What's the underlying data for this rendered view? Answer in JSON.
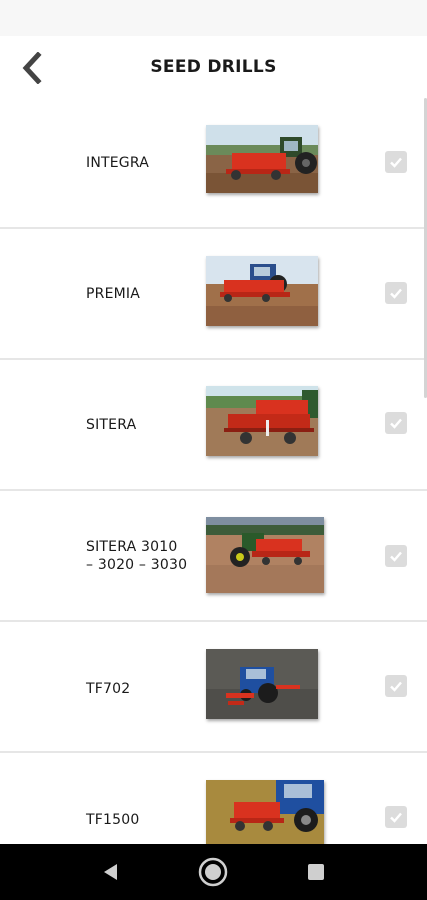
{
  "header": {
    "title": "SEED DRILLS",
    "back_icon": "chevron-left-icon"
  },
  "colors": {
    "status_bar": "#f7f7f7",
    "divider": "#e6e6e6",
    "checkbox_bg": "#dcdcdc",
    "nav_bar": "#000000",
    "machine_red": "#d9321f"
  },
  "items": [
    {
      "label": "INTEGRA",
      "checked": true,
      "image": "integra-photo"
    },
    {
      "label": "PREMIA",
      "checked": true,
      "image": "premia-photo"
    },
    {
      "label": "SITERA",
      "checked": true,
      "image": "sitera-photo"
    },
    {
      "label_line1": "SITERA 3010",
      "label_line2": "– 3020 – 3030",
      "checked": true,
      "image": "sitera-3010-photo"
    },
    {
      "label": "TF702",
      "checked": true,
      "image": "tf702-photo"
    },
    {
      "label": "TF1500",
      "checked": true,
      "image": "tf1500-photo"
    }
  ],
  "nav": {
    "back": "triangle-back-icon",
    "home": "circle-home-icon",
    "recents": "square-recents-icon"
  }
}
